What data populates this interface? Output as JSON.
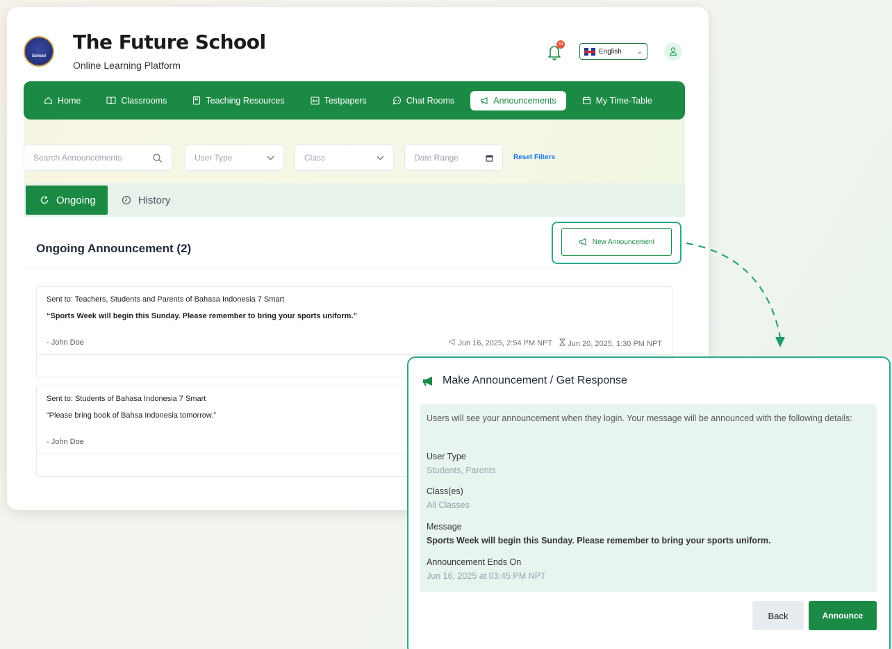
{
  "header": {
    "logo_text": "School",
    "title": "The Future School",
    "subtitle": "Online Learning Platform",
    "notification_count": "43",
    "language": "English"
  },
  "nav": {
    "items": [
      {
        "label": "Home",
        "icon": "home-icon"
      },
      {
        "label": "Classrooms",
        "icon": "book-open-icon"
      },
      {
        "label": "Teaching Resources",
        "icon": "book-icon"
      },
      {
        "label": "Testpapers",
        "icon": "testpaper-icon"
      },
      {
        "label": "Chat Rooms",
        "icon": "chat-icon"
      },
      {
        "label": "Announcements",
        "icon": "megaphone-icon",
        "active": true
      },
      {
        "label": "My Time-Table",
        "icon": "calendar-icon"
      }
    ]
  },
  "filters": {
    "search_placeholder": "Search Announcements",
    "user_type": "User Type",
    "class": "Class",
    "date_range": "Date Range",
    "reset": "Reset Filters"
  },
  "tabs": [
    {
      "label": "Ongoing",
      "active": true
    },
    {
      "label": "History"
    }
  ],
  "panel": {
    "title": "Ongoing Announcement (2)",
    "new_button": "New Announcement"
  },
  "announcements": [
    {
      "sent_to": "Sent to: Teachers, Students and Parents of Bahasa Indonesia 7 Smart",
      "message": "“Sports Week will begin this Sunday. Please remember to bring your sports uniform.”",
      "author": "- John Doe",
      "posted": "Jun 16, 2025, 2:54 PM NPT",
      "ends": "Jun 20, 2025, 1:30 PM NPT"
    },
    {
      "sent_to": "Sent to: Students of Bahasa Indonesia 7 Smart",
      "message": "“Please bring book of Bahsa Indonesia tomorrow.”",
      "author": "- John Doe"
    }
  ],
  "modal": {
    "title": "Make Announcement / Get Response",
    "intro": "Users will see your announcement when they login. Your message will be announced with the following details:",
    "user_type_label": "User Type",
    "user_type_value": "Students, Parents",
    "classes_label": "Class(es)",
    "classes_value": "All Classes",
    "message_label": "Message",
    "message_value": "Sports Week will begin this Sunday. Please remember to bring your sports uniform.",
    "ends_label": "Announcement Ends On",
    "ends_value": "Jun 16, 2025 at 03:45 PM NPT",
    "back": "Back",
    "announce": "Announce"
  },
  "colors": {
    "brand_green": "#1b8a44",
    "highlight_teal": "#2aa88a",
    "panel_tint": "#e8f4ee"
  }
}
